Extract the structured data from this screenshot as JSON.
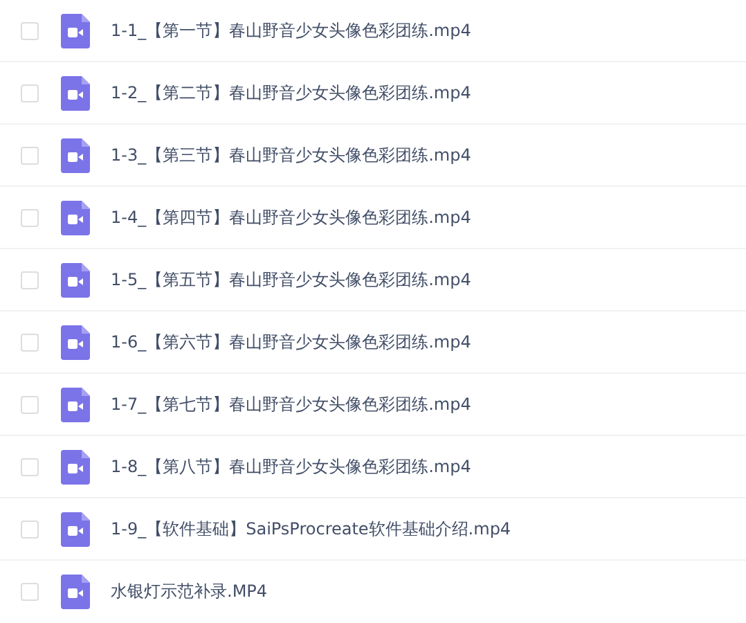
{
  "files": [
    {
      "name": "1-1_【第一节】春山野音少女头像色彩团练.mp4",
      "checked": false
    },
    {
      "name": "1-2_【第二节】春山野音少女头像色彩团练.mp4",
      "checked": false
    },
    {
      "name": "1-3_【第三节】春山野音少女头像色彩团练.mp4",
      "checked": false
    },
    {
      "name": "1-4_【第四节】春山野音少女头像色彩团练.mp4",
      "checked": false
    },
    {
      "name": "1-5_【第五节】春山野音少女头像色彩团练.mp4",
      "checked": false
    },
    {
      "name": "1-6_【第六节】春山野音少女头像色彩团练.mp4",
      "checked": false
    },
    {
      "name": "1-7_【第七节】春山野音少女头像色彩团练.mp4",
      "checked": false
    },
    {
      "name": "1-8_【第八节】春山野音少女头像色彩团练.mp4",
      "checked": false
    },
    {
      "name": "1-9_【软件基础】SaiPsProcreate软件基础介绍.mp4",
      "checked": false
    },
    {
      "name": "水银灯示范补录.MP4",
      "checked": false
    }
  ]
}
